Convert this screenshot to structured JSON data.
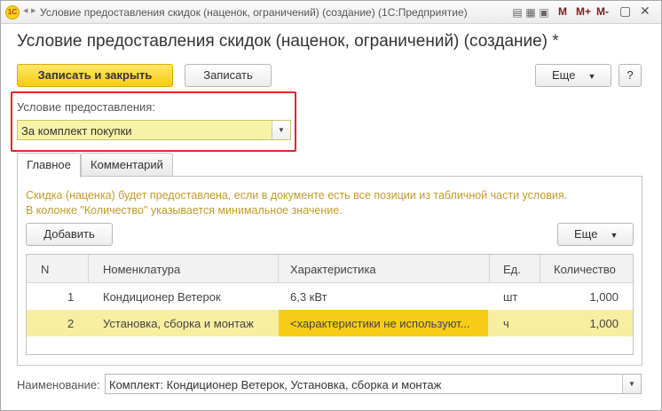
{
  "window": {
    "app_logo_text": "1C",
    "title": "Условие предоставления скидок (наценок, ограничений) (создание)  (1С:Предприятие)",
    "m_labels": [
      "M",
      "M+",
      "M-"
    ]
  },
  "form": {
    "title": "Условие предоставления скидок (наценок, ограничений) (создание) *"
  },
  "toolbar": {
    "save_close_label": "Записать и закрыть",
    "save_label": "Записать",
    "more_label": "Еще",
    "help_label": "?"
  },
  "condition": {
    "label": "Условие предоставления:",
    "value": "За комплект покупки"
  },
  "tabs": [
    {
      "label": "Главное",
      "active": true
    },
    {
      "label": "Комментарий",
      "active": false
    }
  ],
  "info_text": [
    "Скидка (наценка) будет предоставлена, если в документе есть все позиции из табличной части условия.",
    "В колонке \"Количество\" указывается минимальное значение."
  ],
  "table_toolbar": {
    "add_label": "Добавить",
    "more_label": "Еще"
  },
  "table": {
    "columns": [
      "N",
      "Номенклатура",
      "Характеристика",
      "Ед.",
      "Количество"
    ],
    "rows": [
      {
        "n": "1",
        "item": "Кондиционер Ветерок",
        "characteristic": "6,3 кВт",
        "unit": "шт",
        "qty": "1,000"
      },
      {
        "n": "2",
        "item": "Установка, сборка и монтаж",
        "characteristic": "<характеристики не используют...",
        "unit": "ч",
        "qty": "1,000"
      }
    ]
  },
  "name_field": {
    "label": "Наименование:",
    "value": "Комплект: Кондиционер Ветерок, Установка, сборка и монтаж"
  },
  "colors": {
    "accent_yellow": "#f6cb13",
    "highlight_red": "#e0262a",
    "selected_row": "#f7eea0",
    "info_text": "#c19a2a"
  }
}
